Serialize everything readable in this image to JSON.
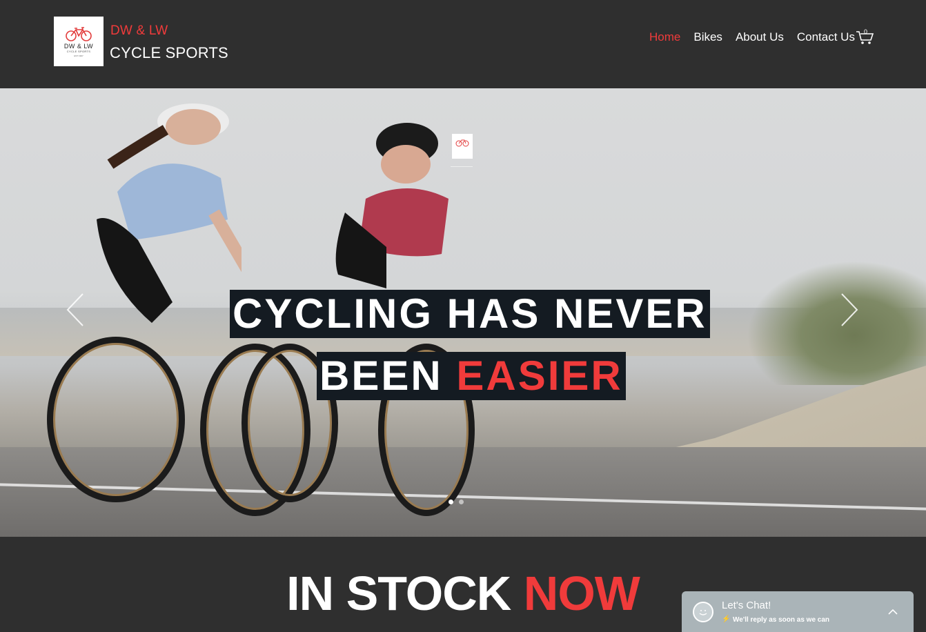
{
  "header": {
    "logo": {
      "line1": "DW & LW",
      "line2": "CYCLE SPORTS",
      "line3": "EST 1997",
      "icon": "bicycle-icon",
      "accent": "#f03b3b"
    },
    "brand_line1": "DW & LW",
    "brand_line2": "CYCLE SPORTS",
    "nav": [
      {
        "label": "Home",
        "active": true
      },
      {
        "label": "Bikes",
        "active": false
      },
      {
        "label": "About Us",
        "active": false
      },
      {
        "label": "Contact Us",
        "active": false
      }
    ],
    "cart": {
      "icon": "cart-icon",
      "count": "0"
    }
  },
  "hero": {
    "headline_line1": "CYCLING HAS NEVER",
    "headline_line2_prefix": "BEEN ",
    "headline_line2_accent": "EASIER",
    "prev_icon": "chevron-left-icon",
    "next_icon": "chevron-right-icon",
    "slides": 2,
    "active_slide": 1
  },
  "section": {
    "title_prefix": "IN STOCK ",
    "title_accent": "NOW"
  },
  "chat": {
    "title": "Let's Chat!",
    "subtitle": "We'll reply as soon as we can",
    "icon": "smiley-icon",
    "toggle_icon": "chevron-up-icon"
  },
  "colors": {
    "accent": "#f03b3b",
    "header_bg": "#2f2f2f",
    "headline_bg": "#141b22",
    "chat_bg": "#aab4b8"
  }
}
